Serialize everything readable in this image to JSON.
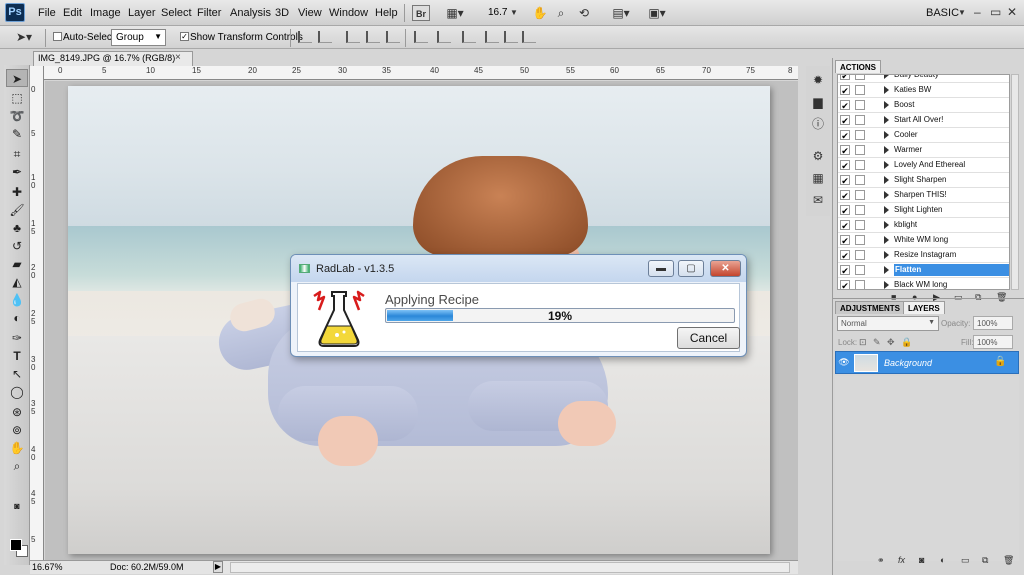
{
  "app": {
    "logo": "Ps",
    "workspace": "BASIC"
  },
  "menus": [
    "File",
    "Edit",
    "Image",
    "Layer",
    "Select",
    "Filter",
    "Analysis",
    "3D",
    "View",
    "Window",
    "Help"
  ],
  "toolbar": {
    "bridge": "Br",
    "zoom": "16.7"
  },
  "options": {
    "auto_select_label": "Auto-Select:",
    "auto_select_value": "Group",
    "transform_label": "Show Transform Controls",
    "transform_checked": "✓"
  },
  "document": {
    "tab_title": "IMG_8149.JPG @ 16.7% (RGB/8)",
    "close": "×"
  },
  "ruler_h": [
    "0",
    "5",
    "10",
    "15",
    "20",
    "25",
    "30",
    "35",
    "40",
    "45",
    "50",
    "55",
    "60",
    "65",
    "70",
    "75",
    "8"
  ],
  "ruler_v": [
    "0",
    "5",
    "1 0",
    "1 5",
    "2 0",
    "2 5",
    "3 0",
    "3 5",
    "4 0",
    "4 5",
    "5"
  ],
  "status": {
    "zoom": "16.67%",
    "doc": "Doc: 60.2M/59.0M",
    "arrow": "▶"
  },
  "actions_panel": {
    "tab": "ACTIONS",
    "items": [
      {
        "label": "Daily Beauty"
      },
      {
        "label": "Katies BW"
      },
      {
        "label": "Boost"
      },
      {
        "label": "Start All Over!"
      },
      {
        "label": "Cooler"
      },
      {
        "label": "Warmer"
      },
      {
        "label": "Lovely And Ethereal"
      },
      {
        "label": "Slight Sharpen"
      },
      {
        "label": "Sharpen THIS!"
      },
      {
        "label": "Slight Lighten"
      },
      {
        "label": "kblight"
      },
      {
        "label": "White WM long"
      },
      {
        "label": "Resize Instagram"
      },
      {
        "label": "Flatten",
        "selected": true
      },
      {
        "label": "Black WM long"
      }
    ],
    "check": "✔"
  },
  "layers_panel": {
    "tabs": [
      "ADJUSTMENTS",
      "LAYERS"
    ],
    "blend_mode": "Normal",
    "opacity_label": "Opacity:",
    "opacity": "100%",
    "lock_label": "Lock:",
    "fill_label": "Fill:",
    "fill": "100%",
    "layer_name": "Background"
  },
  "dialog": {
    "title": "RadLab - v1.3.5",
    "status": "Applying Recipe",
    "progress_text": "19%",
    "progress_fraction": 0.19,
    "cancel": "Cancel",
    "min": "▬",
    "max": "▢",
    "close": "✕"
  }
}
